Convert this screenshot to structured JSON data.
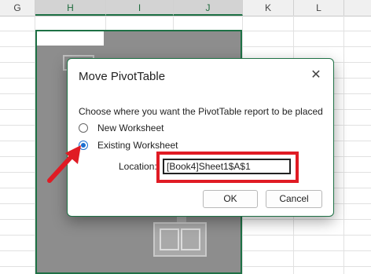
{
  "sheet": {
    "columns": [
      "G",
      "H",
      "I",
      "J",
      "K",
      "L"
    ],
    "selected_columns": [
      "H",
      "I",
      "J"
    ]
  },
  "dialog": {
    "title": "Move PivotTable",
    "close_glyph": "✕",
    "prompt": "Choose where you want the PivotTable report to be placed",
    "options": [
      {
        "label": "New Worksheet",
        "checked": false
      },
      {
        "label": "Existing Worksheet",
        "checked": true
      }
    ],
    "location_label": "Location:",
    "location_value": "[Book4]Sheet1$A$1",
    "ok_label": "OK",
    "cancel_label": "Cancel"
  },
  "annotation": {
    "highlight_color": "#e01b24",
    "arrow_color": "#e01b24"
  },
  "accent_color": "#1e7145"
}
